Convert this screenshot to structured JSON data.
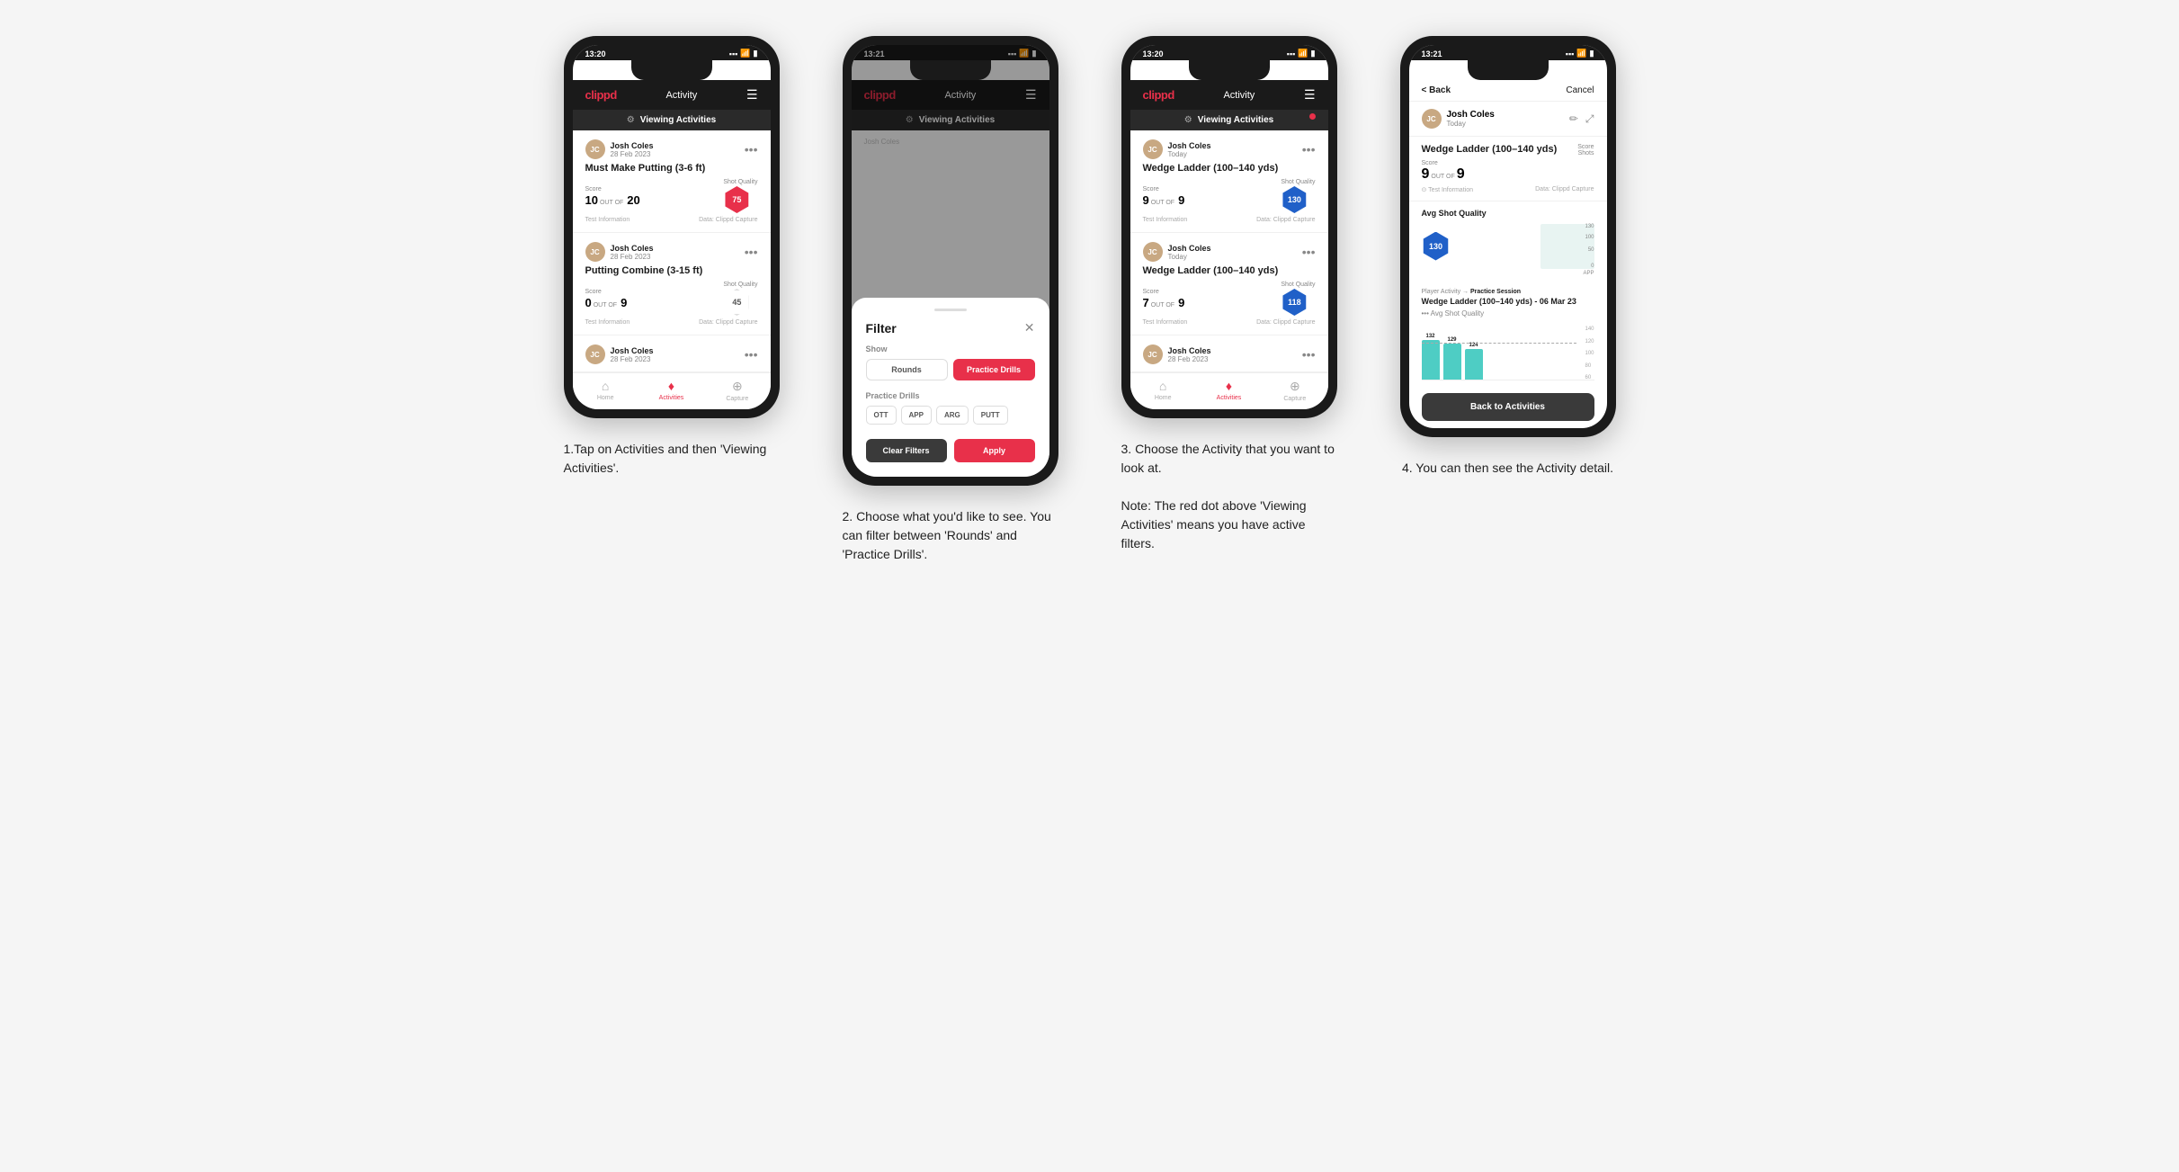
{
  "phones": [
    {
      "id": "phone1",
      "status_time": "13:20",
      "app_logo": "clippd",
      "app_title": "Activity",
      "filter_label": "Viewing Activities",
      "has_red_dot": false,
      "cards": [
        {
          "user_name": "Josh Coles",
          "user_date": "28 Feb 2023",
          "activity_name": "Must Make Putting (3-6 ft)",
          "score_label": "Score",
          "score_value": "10",
          "shots_label": "Shots",
          "shots_outof": "OUT OF",
          "shots_value": "20",
          "quality_label": "Shot Quality",
          "quality_value": "75",
          "quality_color": "red",
          "footer_left": "Test Information",
          "footer_right": "Data: Clippd Capture"
        },
        {
          "user_name": "Josh Coles",
          "user_date": "28 Feb 2023",
          "activity_name": "Putting Combine (3-15 ft)",
          "score_label": "Score",
          "score_value": "0",
          "shots_label": "Shots",
          "shots_outof": "OUT OF",
          "shots_value": "9",
          "quality_label": "Shot Quality",
          "quality_value": "45",
          "quality_color": "outline",
          "footer_left": "Test Information",
          "footer_right": "Data: Clippd Capture"
        }
      ],
      "nav": [
        "Home",
        "Activities",
        "Capture"
      ],
      "active_nav": "Activities"
    },
    {
      "id": "phone2",
      "status_time": "13:21",
      "app_logo": "clippd",
      "app_title": "Activity",
      "filter_label": "Viewing Activities",
      "modal": {
        "title": "Filter",
        "show_label": "Show",
        "buttons": [
          "Rounds",
          "Practice Drills"
        ],
        "active_button": "Practice Drills",
        "practice_label": "Practice Drills",
        "drill_buttons": [
          "OTT",
          "APP",
          "ARG",
          "PUTT"
        ],
        "clear_label": "Clear Filters",
        "apply_label": "Apply"
      },
      "nav": [
        "Home",
        "Activities",
        "Capture"
      ],
      "active_nav": "Activities"
    },
    {
      "id": "phone3",
      "status_time": "13:20",
      "app_logo": "clippd",
      "app_title": "Activity",
      "filter_label": "Viewing Activities",
      "has_red_dot": true,
      "cards": [
        {
          "user_name": "Josh Coles",
          "user_date": "Today",
          "activity_name": "Wedge Ladder (100–140 yds)",
          "score_label": "Score",
          "score_value": "9",
          "shots_label": "Shots",
          "shots_outof": "OUT OF",
          "shots_value": "9",
          "quality_label": "Shot Quality",
          "quality_value": "130",
          "quality_color": "blue",
          "footer_left": "Test Information",
          "footer_right": "Data: Clippd Capture"
        },
        {
          "user_name": "Josh Coles",
          "user_date": "Today",
          "activity_name": "Wedge Ladder (100–140 yds)",
          "score_label": "Score",
          "score_value": "7",
          "shots_label": "Shots",
          "shots_outof": "OUT OF",
          "shots_value": "9",
          "quality_label": "Shot Quality",
          "quality_value": "118",
          "quality_color": "blue",
          "footer_left": "Test Information",
          "footer_right": "Data: Clippd Capture"
        },
        {
          "user_name": "Josh Coles",
          "user_date": "28 Feb 2023",
          "activity_name": "",
          "truncated": true
        }
      ],
      "nav": [
        "Home",
        "Activities",
        "Capture"
      ],
      "active_nav": "Activities"
    },
    {
      "id": "phone4",
      "status_time": "13:21",
      "back_label": "< Back",
      "cancel_label": "Cancel",
      "user_name": "Josh Coles",
      "user_date": "Today",
      "drill_name": "Wedge Ladder (100–140 yds)",
      "score_label": "Score",
      "score_value": "9",
      "shots_label": "Shots",
      "shots_outof": "OUT OF",
      "shots_value": "9",
      "avg_sq_label": "Avg Shot Quality",
      "avg_sq_value": "130",
      "chart_y_labels": [
        "100",
        "50",
        "0"
      ],
      "chart_x_label": "APP",
      "player_activity": "Player Activity",
      "session_type": "Practice Session",
      "session_title": "Wedge Ladder (100–140 yds) - 06 Mar 23",
      "session_subtitle": "••• Avg Shot Quality",
      "bar_values": [
        "132",
        "129",
        "124"
      ],
      "y_axis": [
        "140",
        "120",
        "100",
        "80",
        "60"
      ],
      "back_to_activities": "Back to Activities",
      "info_label": "Test Information",
      "data_label": "Data: Clippd Capture"
    }
  ],
  "captions": [
    "1.Tap on Activities and then 'Viewing Activities'.",
    "2. Choose what you'd like to see. You can filter between 'Rounds' and 'Practice Drills'.",
    "3. Choose the Activity that you want to look at.\n\nNote: The red dot above 'Viewing Activities' means you have active filters.",
    "4. You can then see the Activity detail."
  ]
}
